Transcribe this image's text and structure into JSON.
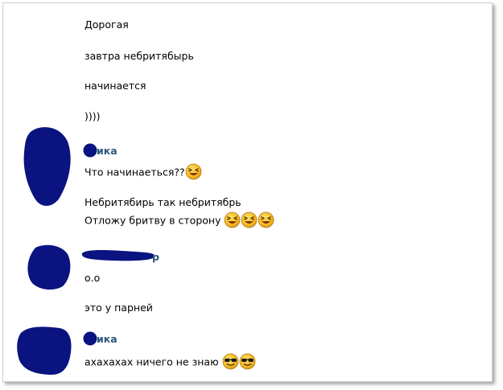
{
  "messages": {
    "m1": "Дорогая",
    "m2": "завтра небритябырь",
    "m3": "начинается",
    "m4": "))))",
    "name1": "ика",
    "m5": "Что начинаеться??",
    "m6": "Небритябирь так небритябрь",
    "m7": "Отложу бритву в сторону",
    "name2": "р",
    "m8": "о.о",
    "m9": "это у парней",
    "name3": "ика",
    "m10": "ахахахах ничего не знаю"
  },
  "emojis": {
    "laugh": "laughing-face",
    "cool": "sunglasses-face"
  },
  "colors": {
    "blot": "#0a1380",
    "name": "#2b587a",
    "emoji_yellow": "#f6b820"
  }
}
